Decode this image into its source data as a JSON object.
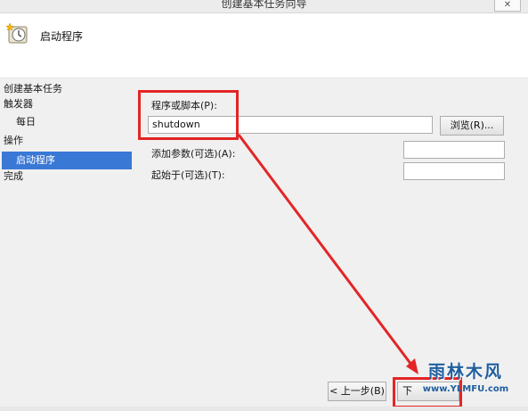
{
  "window": {
    "title": "创建基本任务向导",
    "close_glyph": "✕"
  },
  "header": {
    "title": "启动程序",
    "icon": "clock-wizard-icon"
  },
  "sidebar": {
    "items": [
      {
        "label": "创建基本任务"
      },
      {
        "label": "触发器"
      },
      {
        "label": "每日"
      },
      {
        "label": "操作"
      },
      {
        "label": "启动程序",
        "selected": true
      },
      {
        "label": "完成"
      }
    ]
  },
  "form": {
    "program_label": "程序或脚本(P):",
    "program_value": "shutdown",
    "browse_label": "浏览(R)...",
    "args_label": "添加参数(可选)(A):",
    "args_value": "",
    "start_in_label": "起始于(可选)(T):",
    "start_in_value": ""
  },
  "footer": {
    "back_label": "< 上一步(B)",
    "next_label": "下"
  },
  "watermark": {
    "title": "雨林木风",
    "url": "www.YLMFU.com"
  },
  "colors": {
    "annotation": "#e32526",
    "selection": "#3a78d6",
    "watermark": "#1f5e9e"
  }
}
